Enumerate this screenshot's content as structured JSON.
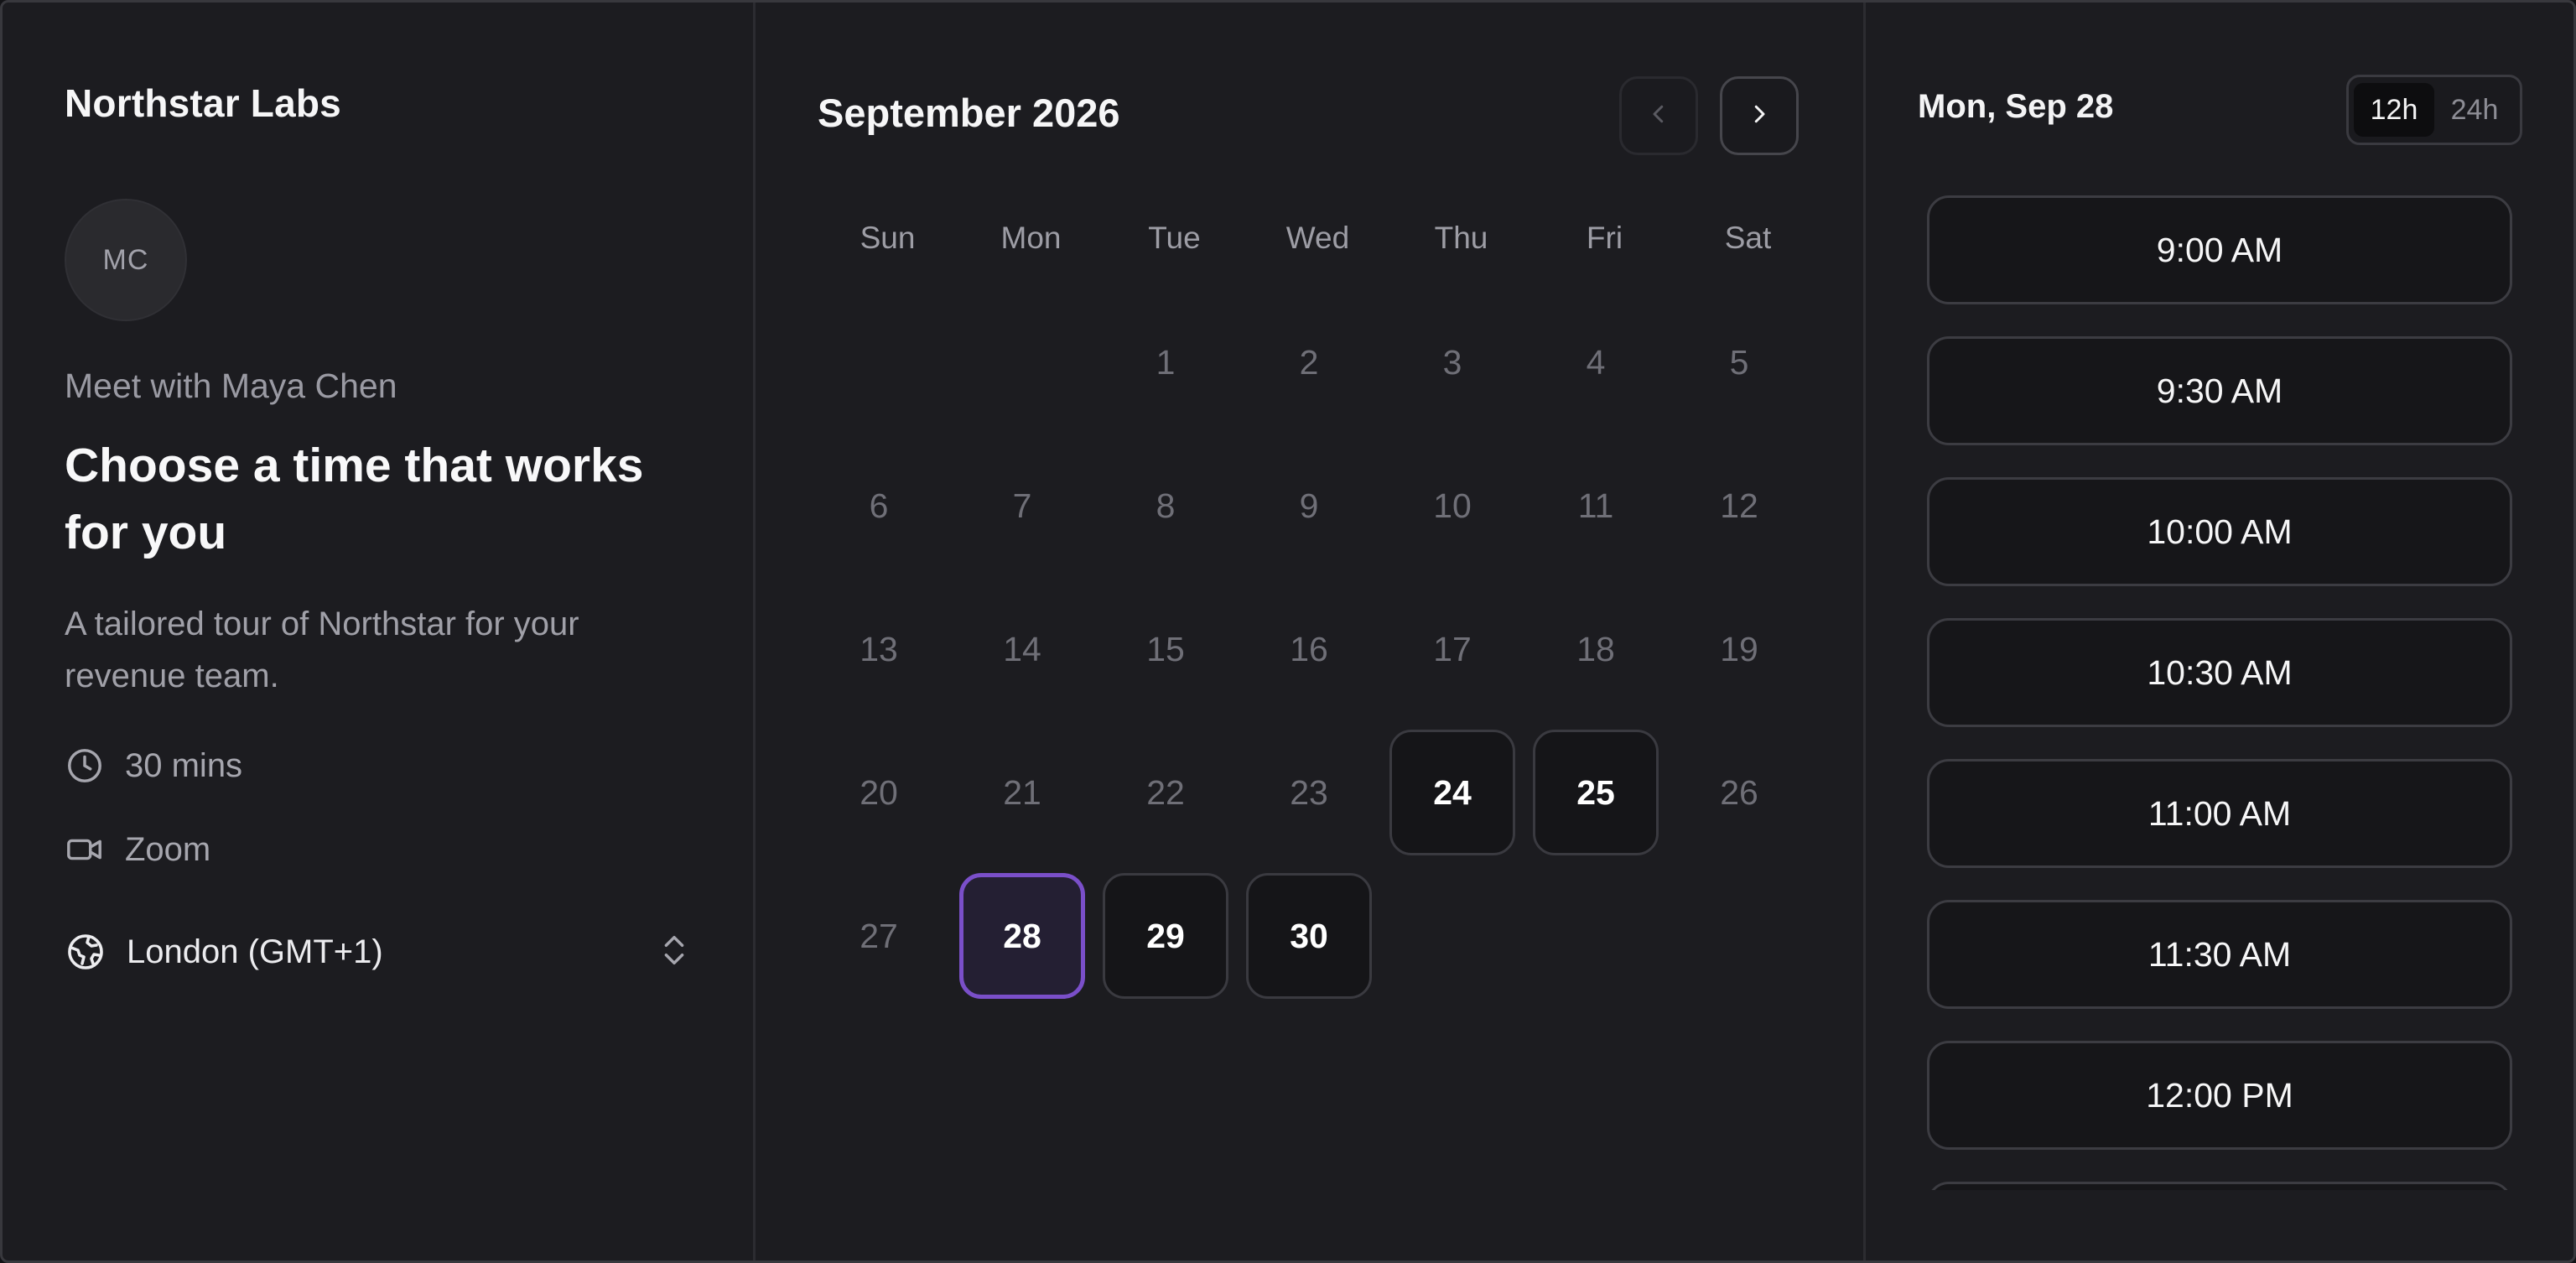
{
  "org": {
    "name": "Northstar Labs"
  },
  "host": {
    "initials": "MC",
    "meet_text": "Meet with Maya Chen"
  },
  "event": {
    "title": "Choose a time that works for you",
    "description": "A tailored tour of Northstar for your revenue team.",
    "duration": "30 mins",
    "location": "Zoom",
    "duration_icon": "clock-icon",
    "location_icon": "video-camera-icon"
  },
  "timezone": {
    "label": "London (GMT+1)",
    "icon": "globe-icon",
    "selector_icon": "chevron-up-down-icon"
  },
  "calendar": {
    "month_label": "September 2026",
    "prev_icon": "chevron-left-icon",
    "next_icon": "chevron-right-icon",
    "weekdays": [
      "Sun",
      "Mon",
      "Tue",
      "Wed",
      "Thu",
      "Fri",
      "Sat"
    ],
    "leading_blanks": 2,
    "days": [
      "1",
      "2",
      "3",
      "4",
      "5",
      "6",
      "7",
      "8",
      "9",
      "10",
      "11",
      "12",
      "13",
      "14",
      "15",
      "16",
      "17",
      "18",
      "19",
      "20",
      "21",
      "22",
      "23",
      "24",
      "25",
      "26",
      "27",
      "28",
      "29",
      "30"
    ],
    "available_days": [
      "24",
      "25",
      "28",
      "29",
      "30"
    ],
    "selected_day": "28",
    "accent_color": "#7a4fc9"
  },
  "slots_panel": {
    "date_label": "Mon, Sep 28",
    "format_options": [
      "12h",
      "24h"
    ],
    "active_format": "12h",
    "times": [
      "9:00 AM",
      "9:30 AM",
      "10:00 AM",
      "10:30 AM",
      "11:00 AM",
      "11:30 AM",
      "12:00 PM",
      ""
    ]
  }
}
